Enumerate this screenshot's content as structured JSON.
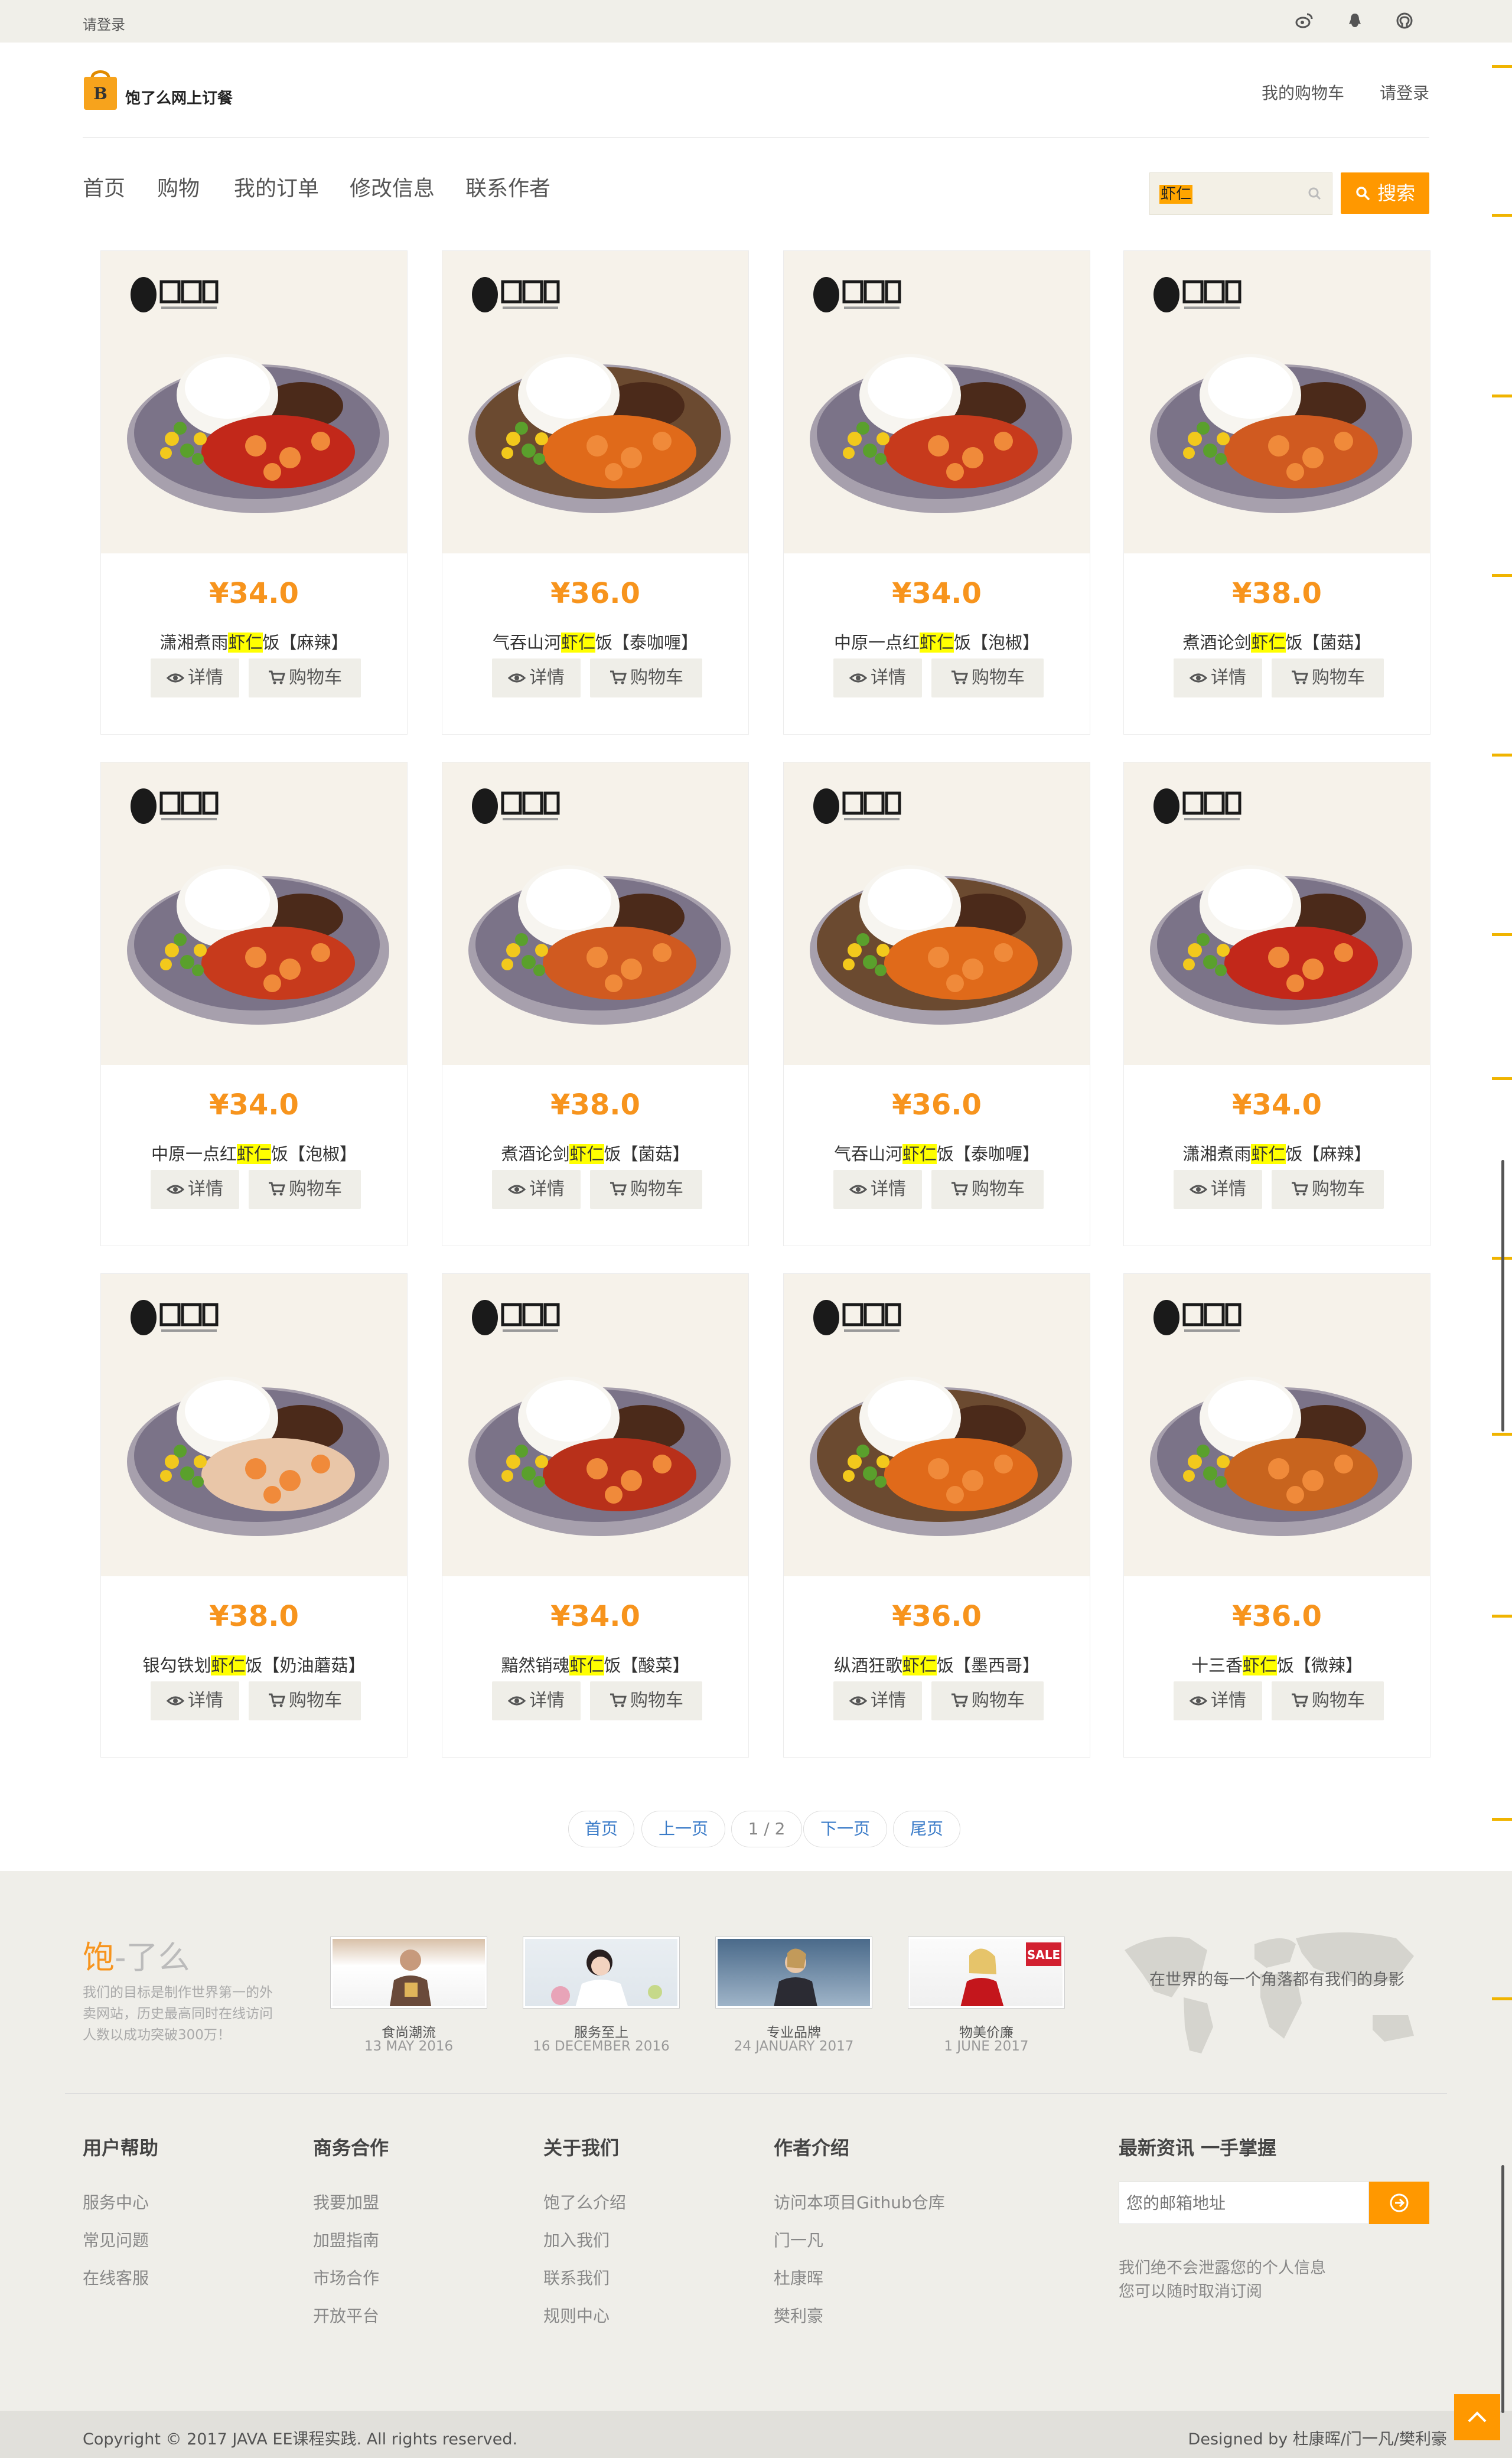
{
  "topbar": {
    "login": "请登录",
    "social": [
      "weibo-icon",
      "qq-icon",
      "github-icon"
    ]
  },
  "header": {
    "logo_text": "饱了么网上订餐",
    "logo_letter": "B",
    "cart_link": "我的购物车",
    "login_link": "请登录"
  },
  "nav": {
    "items": [
      "首页",
      "购物",
      "我的订单",
      "修改信息",
      "联系作者"
    ]
  },
  "search": {
    "value": "虾仁",
    "button": "搜索"
  },
  "products": [
    {
      "price": "¥34.0",
      "prefix": "潇湘煮雨",
      "keyword": "虾仁",
      "suffix": "饭【麻辣】",
      "detail": "详情",
      "cart": "购物车"
    },
    {
      "price": "¥36.0",
      "prefix": "气吞山河",
      "keyword": "虾仁",
      "suffix": "饭【泰咖喱】",
      "detail": "详情",
      "cart": "购物车"
    },
    {
      "price": "¥34.0",
      "prefix": "中原一点红",
      "keyword": "虾仁",
      "suffix": "饭【泡椒】",
      "detail": "详情",
      "cart": "购物车"
    },
    {
      "price": "¥38.0",
      "prefix": "煮酒论剑",
      "keyword": "虾仁",
      "suffix": "饭【菌菇】",
      "detail": "详情",
      "cart": "购物车"
    },
    {
      "price": "¥34.0",
      "prefix": "中原一点红",
      "keyword": "虾仁",
      "suffix": "饭【泡椒】",
      "detail": "详情",
      "cart": "购物车"
    },
    {
      "price": "¥38.0",
      "prefix": "煮酒论剑",
      "keyword": "虾仁",
      "suffix": "饭【菌菇】",
      "detail": "详情",
      "cart": "购物车"
    },
    {
      "price": "¥36.0",
      "prefix": "气吞山河",
      "keyword": "虾仁",
      "suffix": "饭【泰咖喱】",
      "detail": "详情",
      "cart": "购物车"
    },
    {
      "price": "¥34.0",
      "prefix": "潇湘煮雨",
      "keyword": "虾仁",
      "suffix": "饭【麻辣】",
      "detail": "详情",
      "cart": "购物车"
    },
    {
      "price": "¥38.0",
      "prefix": "银勾铁划",
      "keyword": "虾仁",
      "suffix": "饭【奶油蘑菇】",
      "detail": "详情",
      "cart": "购物车"
    },
    {
      "price": "¥34.0",
      "prefix": "黯然销魂",
      "keyword": "虾仁",
      "suffix": "饭【酸菜】",
      "detail": "详情",
      "cart": "购物车"
    },
    {
      "price": "¥36.0",
      "prefix": "纵酒狂歌",
      "keyword": "虾仁",
      "suffix": "饭【墨西哥】",
      "detail": "详情",
      "cart": "购物车"
    },
    {
      "price": "¥36.0",
      "prefix": "十三香",
      "keyword": "虾仁",
      "suffix": "饭【微辣】",
      "detail": "详情",
      "cart": "购物车"
    }
  ],
  "pagination": {
    "first": "首页",
    "prev": "上一页",
    "current": "1 / 2",
    "next": "下一页",
    "last": "尾页"
  },
  "footer": {
    "brand_main": "饱",
    "brand_rest": "-了么",
    "desc": "我们的目标是制作世界第一的外卖网站，历史最高同时在线访问人数以成功突破300万！",
    "thumbs": [
      {
        "title": "食尚潮流",
        "date": "13 MAY 2016"
      },
      {
        "title": "服务至上",
        "date": "16 DECEMBER 2016"
      },
      {
        "title": "专业品牌",
        "date": "24 JANUARY 2017"
      },
      {
        "title": "物美价廉",
        "date": "1 JUNE 2017"
      }
    ],
    "map_text": "在世界的每一个角落都有我们的身影",
    "columns": [
      {
        "title": "用户帮助",
        "links": [
          "服务中心",
          "常见问题",
          "在线客服"
        ]
      },
      {
        "title": "商务合作",
        "links": [
          "我要加盟",
          "加盟指南",
          "市场合作",
          "开放平台"
        ]
      },
      {
        "title": "关于我们",
        "links": [
          "饱了么介绍",
          "加入我们",
          "联系我们",
          "规则中心"
        ]
      },
      {
        "title": "作者介绍",
        "links": [
          "访问本项目Github仓库",
          "门一凡",
          "杜康晖",
          "樊利豪"
        ]
      }
    ],
    "newsletter": {
      "title": "最新资讯 一手掌握",
      "placeholder": "您的邮箱地址",
      "note1": "我们绝不会泄露您的个人信息",
      "note2": "您可以随时取消订阅"
    },
    "copyright": "Copyright © 2017 JAVA EE课程实践. All rights reserved.",
    "designed": "Designed by 杜康晖/门一凡/樊利豪"
  },
  "colors": {
    "accent": "#ff9800",
    "price": "#f7941d",
    "highlight": "#ffff00"
  }
}
